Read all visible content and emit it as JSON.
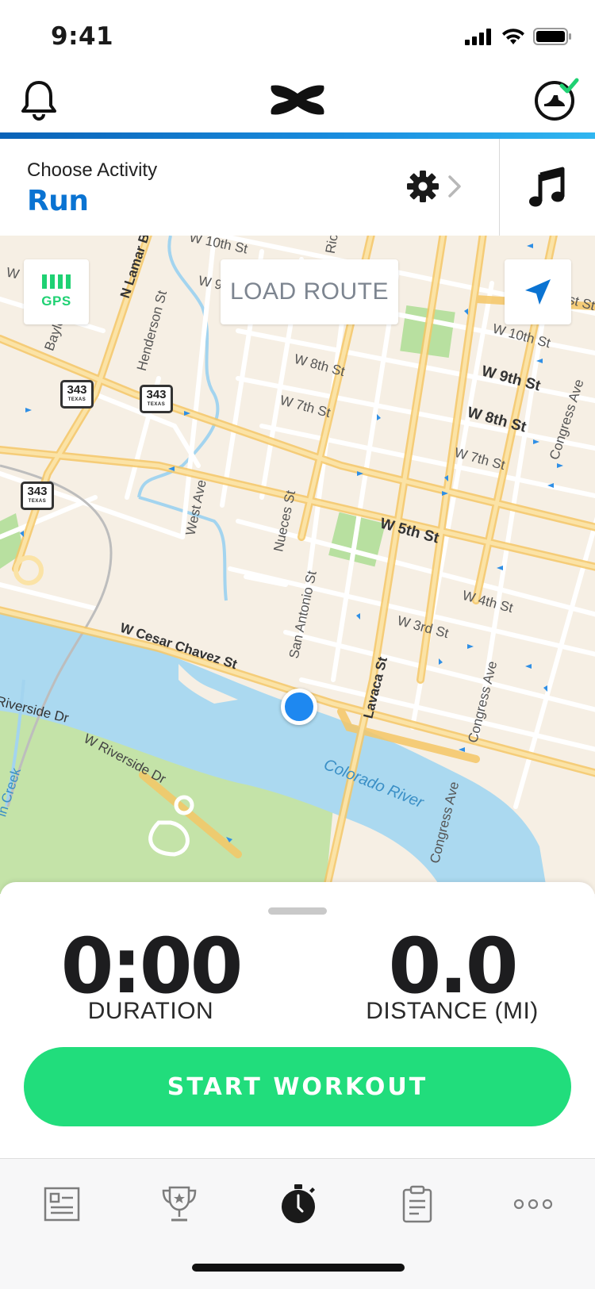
{
  "status_bar": {
    "time": "9:41"
  },
  "header": {
    "brand": "Under Armour"
  },
  "activity": {
    "choose_label": "Choose Activity",
    "selected": "Run"
  },
  "map": {
    "gps_label": "GPS",
    "load_route_label": "LOAD ROUTE",
    "street_labels": {
      "w10th_a": "W 10th St",
      "w10th_b": "W 10th St",
      "w9th": "W 9th St",
      "w8th_a": "W 8th St",
      "w8th_b": "W 8th St",
      "w7th_a": "W 7th St",
      "w7th_b": "W 7th St",
      "w5th": "W 5th St",
      "w4th": "W 4th St",
      "w3rd": "W 3rd St",
      "cesar": "W Cesar Chavez St",
      "riverside_a": "W Riverside Dr",
      "riverside_b": "Riverside Dr",
      "lamar": "N Lamar B",
      "henderson": "Henderson St",
      "baylor": "Baylor",
      "west_ave": "West Ave",
      "nueces": "Nueces St",
      "san_antonio": "San Antonio St",
      "lavaca": "Lavaca St",
      "congress_a": "Congress Ave",
      "congress_b": "Congress Ave",
      "congress_c": "Congress Ave",
      "colorado": "Colorado River",
      "creek": "in Creek",
      "rio": "Rio",
      "w9_frag": "W 9",
      "w_frag": "W",
      "st_frag": "st St"
    },
    "shields": {
      "route_1": "343",
      "route_2": "343",
      "route_3": "343",
      "state": "TEXAS"
    }
  },
  "stats": {
    "duration_value": "0:00",
    "duration_label": "DURATION",
    "distance_value": "0.0",
    "distance_label": "DISTANCE (MI)"
  },
  "start_button": "START WORKOUT",
  "colors": {
    "accent_blue": "#0a73d2",
    "gps_green": "#1fd173",
    "start_green": "#21dd7c"
  },
  "tabs": [
    "feed-icon",
    "challenges-icon",
    "record-icon",
    "plans-icon",
    "more-icon"
  ]
}
